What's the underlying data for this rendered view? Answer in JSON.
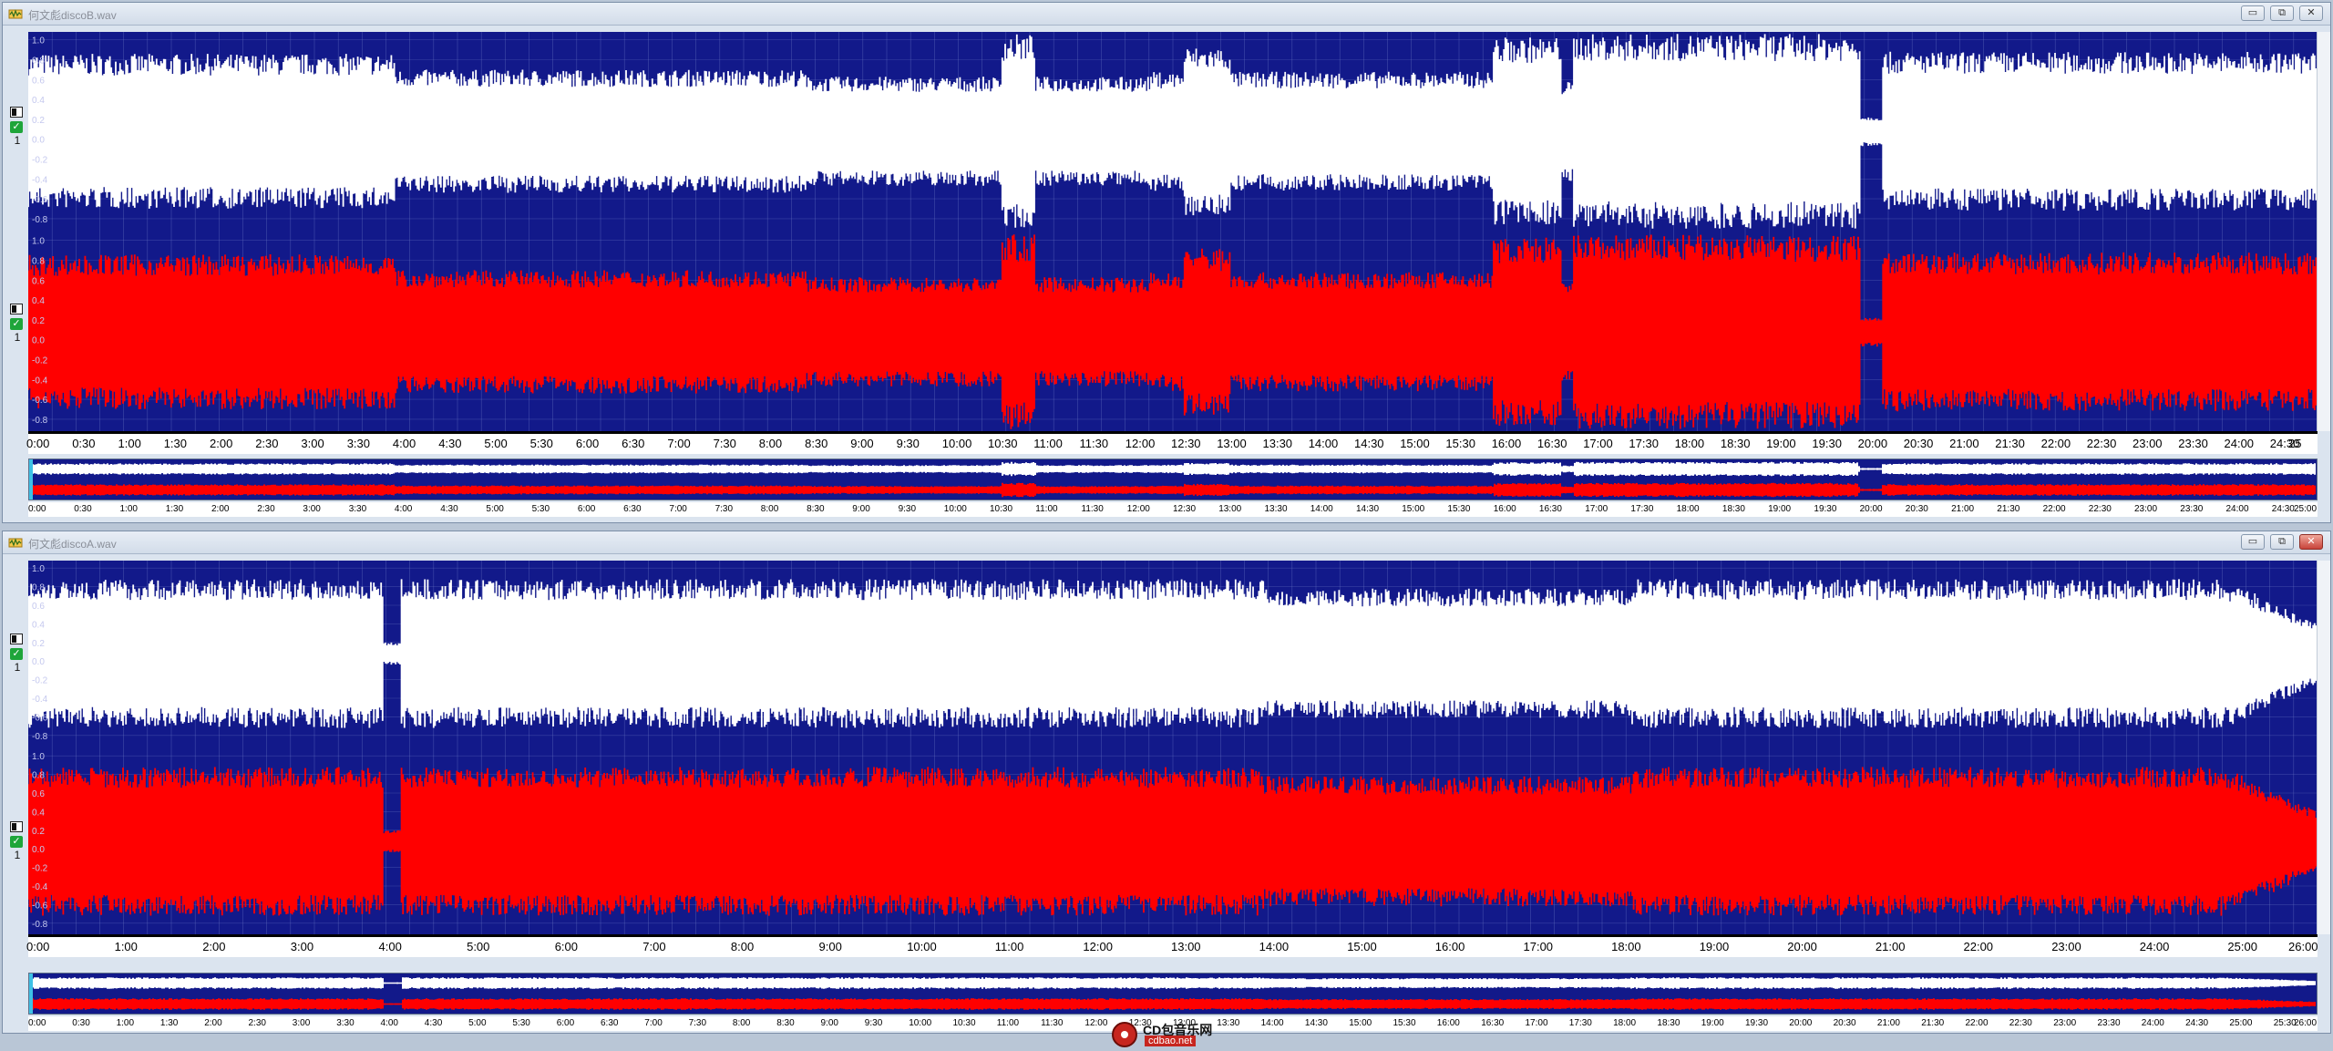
{
  "windows": [
    {
      "title": "何文彪discoB.wav",
      "timeline_labels": [
        "0:00",
        "0:30",
        "1:00",
        "1:30",
        "2:00",
        "2:30",
        "3:00",
        "3:30",
        "4:00",
        "4:30",
        "5:00",
        "5:30",
        "6:00",
        "6:30",
        "7:00",
        "7:30",
        "8:00",
        "8:30",
        "9:00",
        "9:30",
        "10:00",
        "10:30",
        "11:00",
        "11:30",
        "12:00",
        "12:30",
        "13:00",
        "13:30",
        "14:00",
        "14:30",
        "15:00",
        "15:30",
        "16:00",
        "16:30",
        "17:00",
        "17:30",
        "18:00",
        "18:30",
        "19:00",
        "19:30",
        "20:00",
        "20:30",
        "21:00",
        "21:30",
        "22:00",
        "22:30",
        "23:00",
        "23:30",
        "24:00",
        "24:30",
        "25"
      ],
      "overview_labels": [
        "0:00",
        "0:30",
        "1:00",
        "1:30",
        "2:00",
        "2:30",
        "3:00",
        "3:30",
        "4:00",
        "4:30",
        "5:00",
        "5:30",
        "6:00",
        "6:30",
        "7:00",
        "7:30",
        "8:00",
        "8:30",
        "9:00",
        "9:30",
        "10:00",
        "10:30",
        "11:00",
        "11:30",
        "12:00",
        "12:30",
        "13:00",
        "13:30",
        "14:00",
        "14:30",
        "15:00",
        "15:30",
        "16:00",
        "16:30",
        "17:00",
        "17:30",
        "18:00",
        "18:30",
        "19:00",
        "19:30",
        "20:00",
        "20:30",
        "21:00",
        "21:30",
        "22:00",
        "22:30",
        "23:00",
        "23:30",
        "24:00",
        "24:30",
        "25:00"
      ],
      "channel_num": "1"
    },
    {
      "title": "何文彪discoA.wav",
      "timeline_labels": [
        "0:00",
        "1:00",
        "2:00",
        "3:00",
        "4:00",
        "5:00",
        "6:00",
        "7:00",
        "8:00",
        "9:00",
        "10:00",
        "11:00",
        "12:00",
        "13:00",
        "14:00",
        "15:00",
        "16:00",
        "17:00",
        "18:00",
        "19:00",
        "20:00",
        "21:00",
        "22:00",
        "23:00",
        "24:00",
        "25:00",
        "26:00"
      ],
      "overview_labels": [
        "0:00",
        "0:30",
        "1:00",
        "1:30",
        "2:00",
        "2:30",
        "3:00",
        "3:30",
        "4:00",
        "4:30",
        "5:00",
        "5:30",
        "6:00",
        "6:30",
        "7:00",
        "7:30",
        "8:00",
        "8:30",
        "9:00",
        "9:30",
        "10:00",
        "10:30",
        "11:00",
        "11:30",
        "12:00",
        "12:30",
        "13:00",
        "13:30",
        "14:00",
        "14:30",
        "15:00",
        "15:30",
        "16:00",
        "16:30",
        "17:00",
        "17:30",
        "18:00",
        "18:30",
        "19:00",
        "19:30",
        "20:00",
        "20:30",
        "21:00",
        "21:30",
        "22:00",
        "22:30",
        "23:00",
        "23:30",
        "24:00",
        "24:30",
        "25:00",
        "25:30",
        "26:00"
      ],
      "channel_num": "1"
    }
  ],
  "amplitude_scale": [
    "1.0",
    "0.8",
    "0.6",
    "0.4",
    "0.2",
    "0.0",
    "-0.2",
    "-0.4",
    "-0.6",
    "-0.8"
  ],
  "window_buttons": {
    "minimize": "▭",
    "restore": "⧉",
    "close": "✕"
  },
  "colors": {
    "background": "#12198a",
    "left_channel": "#ffffff",
    "right_channel": "#ff0000",
    "grid": "#6a76c4"
  },
  "watermark": {
    "title": "CD包音乐网",
    "url": "cdbao.net"
  }
}
